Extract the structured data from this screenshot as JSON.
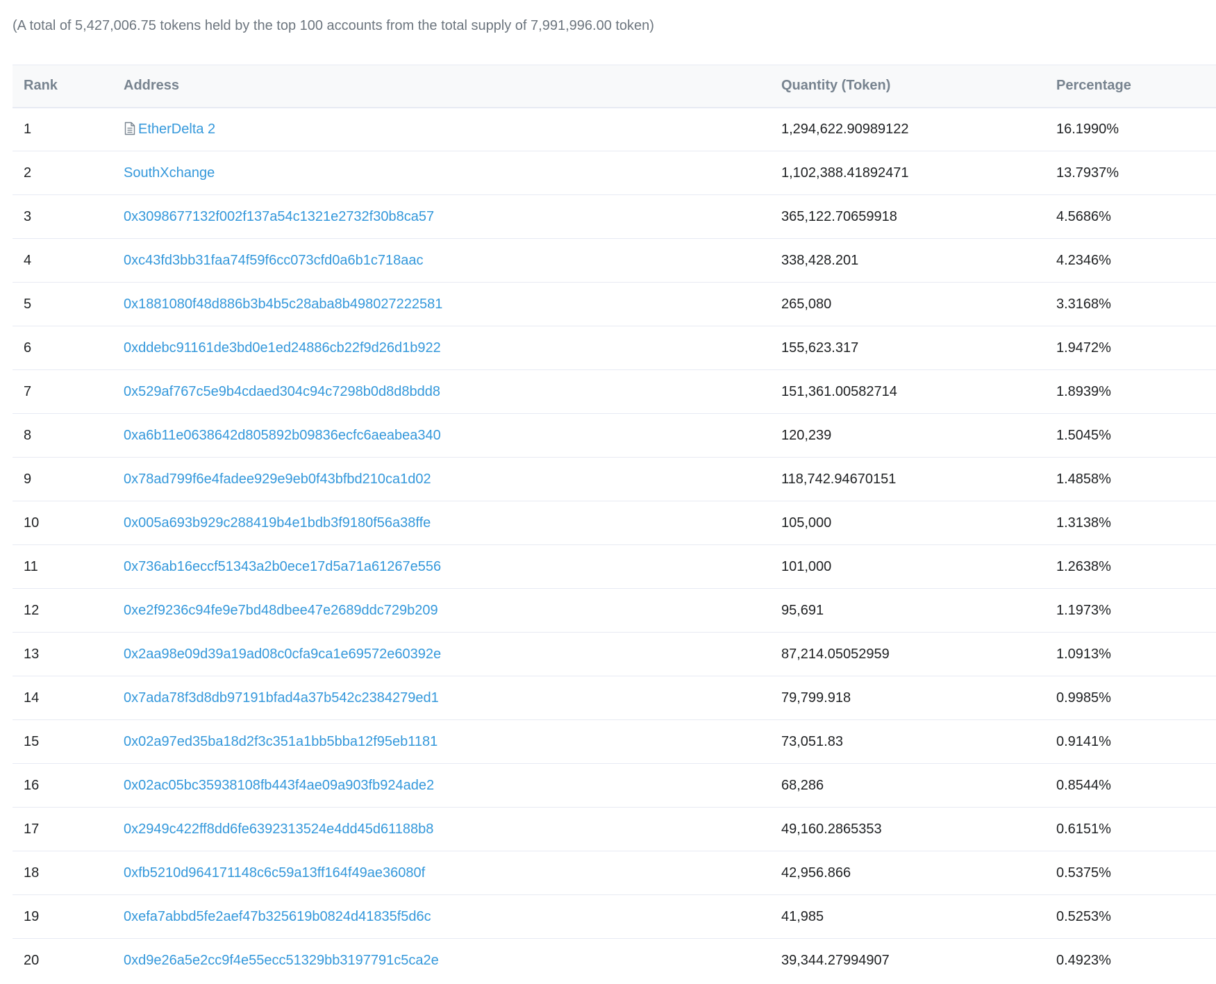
{
  "summary_text": "(A total of 5,427,006.75 tokens held by the top 100 accounts from the total supply of 7,991,996.00 token)",
  "table": {
    "headers": {
      "rank": "Rank",
      "address": "Address",
      "quantity": "Quantity (Token)",
      "percentage": "Percentage"
    },
    "rows": [
      {
        "rank": "1",
        "address": "EtherDelta 2",
        "icon": "contract-file-icon",
        "quantity": "1,294,622.90989122",
        "percentage": "16.1990%"
      },
      {
        "rank": "2",
        "address": "SouthXchange",
        "quantity": "1,102,388.41892471",
        "percentage": "13.7937%"
      },
      {
        "rank": "3",
        "address": "0x3098677132f002f137a54c1321e2732f30b8ca57",
        "quantity": "365,122.70659918",
        "percentage": "4.5686%"
      },
      {
        "rank": "4",
        "address": "0xc43fd3bb31faa74f59f6cc073cfd0a6b1c718aac",
        "quantity": "338,428.201",
        "percentage": "4.2346%"
      },
      {
        "rank": "5",
        "address": "0x1881080f48d886b3b4b5c28aba8b498027222581",
        "quantity": "265,080",
        "percentage": "3.3168%"
      },
      {
        "rank": "6",
        "address": "0xddebc91161de3bd0e1ed24886cb22f9d26d1b922",
        "quantity": "155,623.317",
        "percentage": "1.9472%"
      },
      {
        "rank": "7",
        "address": "0x529af767c5e9b4cdaed304c94c7298b0d8d8bdd8",
        "quantity": "151,361.00582714",
        "percentage": "1.8939%"
      },
      {
        "rank": "8",
        "address": "0xa6b11e0638642d805892b09836ecfc6aeabea340",
        "quantity": "120,239",
        "percentage": "1.5045%"
      },
      {
        "rank": "9",
        "address": "0x78ad799f6e4fadee929e9eb0f43bfbd210ca1d02",
        "quantity": "118,742.94670151",
        "percentage": "1.4858%"
      },
      {
        "rank": "10",
        "address": "0x005a693b929c288419b4e1bdb3f9180f56a38ffe",
        "quantity": "105,000",
        "percentage": "1.3138%"
      },
      {
        "rank": "11",
        "address": "0x736ab16eccf51343a2b0ece17d5a71a61267e556",
        "quantity": "101,000",
        "percentage": "1.2638%"
      },
      {
        "rank": "12",
        "address": "0xe2f9236c94fe9e7bd48dbee47e2689ddc729b209",
        "quantity": "95,691",
        "percentage": "1.1973%"
      },
      {
        "rank": "13",
        "address": "0x2aa98e09d39a19ad08c0cfa9ca1e69572e60392e",
        "quantity": "87,214.05052959",
        "percentage": "1.0913%"
      },
      {
        "rank": "14",
        "address": "0x7ada78f3d8db97191bfad4a37b542c2384279ed1",
        "quantity": "79,799.918",
        "percentage": "0.9985%"
      },
      {
        "rank": "15",
        "address": "0x02a97ed35ba18d2f3c351a1bb5bba12f95eb1181",
        "quantity": "73,051.83",
        "percentage": "0.9141%"
      },
      {
        "rank": "16",
        "address": "0x02ac05bc35938108fb443f4ae09a903fb924ade2",
        "quantity": "68,286",
        "percentage": "0.8544%"
      },
      {
        "rank": "17",
        "address": "0x2949c422ff8dd6fe6392313524e4dd45d61188b8",
        "quantity": "49,160.2865353",
        "percentage": "0.6151%"
      },
      {
        "rank": "18",
        "address": "0xfb5210d964171148c6c59a13ff164f49ae36080f",
        "quantity": "42,956.866",
        "percentage": "0.5375%"
      },
      {
        "rank": "19",
        "address": "0xefa7abbd5fe2aef47b325619b0824d41835f5d6c",
        "quantity": "41,985",
        "percentage": "0.5253%"
      },
      {
        "rank": "20",
        "address": "0xd9e26a5e2cc9f4e55ecc51329bb3197791c5ca2e",
        "quantity": "39,344.27994907",
        "percentage": "0.4923%"
      }
    ]
  },
  "colors": {
    "link": "#3498db",
    "header_bg": "#f8f9fa",
    "border": "#e7eaf3",
    "muted_text": "#6c757e"
  }
}
